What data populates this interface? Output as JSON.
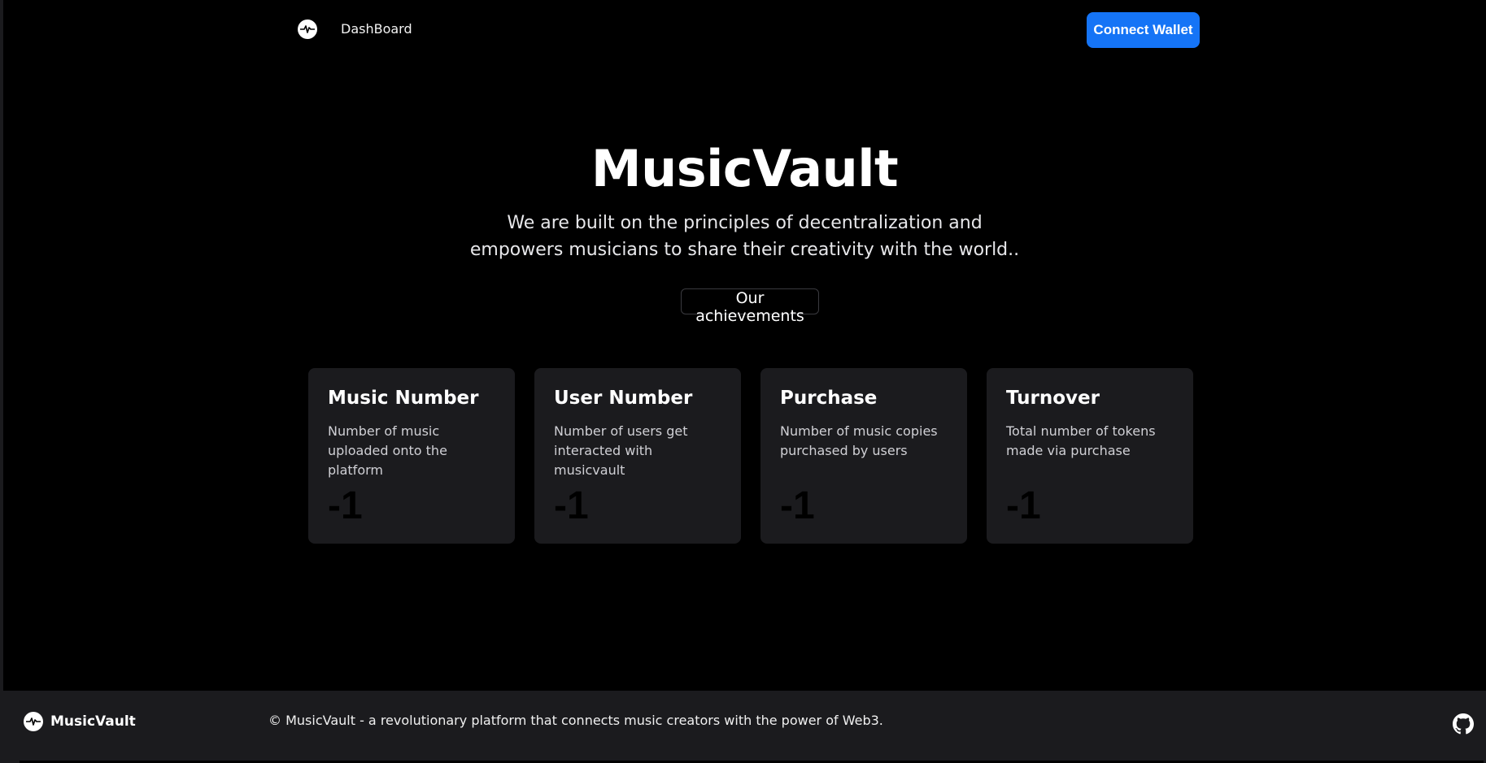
{
  "header": {
    "logo_icon": "pulse-logo-icon",
    "nav_dashboard": "DashBoard",
    "connect_wallet": "Connect Wallet"
  },
  "hero": {
    "title": "MusicVault",
    "subtitle_line1": "We are built on the principles of decentralization and",
    "subtitle_line2": "empowers musicians to share their creativity with the world..",
    "achievements_button": "Our achievements"
  },
  "stats": [
    {
      "title": "Music Number",
      "description": "Number of music uploaded onto the platform",
      "value": "-1"
    },
    {
      "title": "User Number",
      "description": "Number of users get interacted with musicvault",
      "value": "-1"
    },
    {
      "title": "Purchase",
      "description": "Number of music copies purchased by users",
      "value": "-1"
    },
    {
      "title": "Turnover",
      "description": "Total number of tokens made via purchase",
      "value": "-1"
    }
  ],
  "footer": {
    "brand": "MusicVault",
    "copyright": "© MusicVault - a revolutionary platform that connects music creators with the power of Web3.",
    "github_icon": "github-icon"
  },
  "colors": {
    "background": "#000000",
    "card": "#1b1b1e",
    "accent": "#1574f6",
    "footer": "#1b1b1e"
  }
}
